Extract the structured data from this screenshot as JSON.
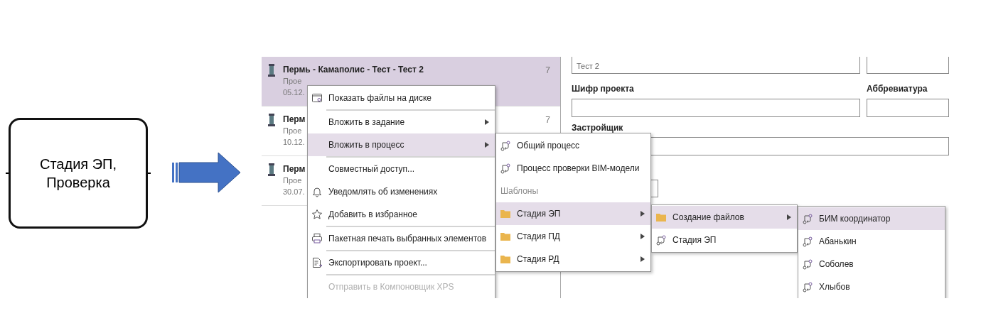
{
  "flow_node": {
    "text": "Стадия ЭП, Проверка"
  },
  "screenshot": {
    "projects": [
      {
        "title": "Пермь - Камаполис - Тест - Тест 2",
        "count": "7",
        "line_2": "Прое",
        "date": "05.12.",
        "selected": true
      },
      {
        "title": "Перм",
        "count": "7",
        "line_2": "Прое",
        "date": "10.12.",
        "selected": false
      },
      {
        "title": "Перм",
        "line_2": "Прое",
        "date": "30.07.",
        "selected": false
      }
    ],
    "form": {
      "field_value": "Тест 2",
      "labels": [
        "Шифр проекта",
        "Аббревиатура",
        "Застройщик"
      ]
    },
    "context_menu": {
      "items": [
        {
          "kind": "window",
          "label": "Показать файлы на диске",
          "has_submenu": false,
          "selected": false,
          "disabled": false
        },
        {
          "kind": "separator"
        },
        {
          "kind": "plain",
          "label": "Вложить в задание",
          "has_submenu": true,
          "selected": false,
          "disabled": false
        },
        {
          "kind": "plain",
          "label": "Вложить в процесс",
          "has_submenu": true,
          "selected": true,
          "disabled": false
        },
        {
          "kind": "separator"
        },
        {
          "kind": "plain",
          "label": "Совместный доступ...",
          "has_submenu": false,
          "selected": false,
          "disabled": false
        },
        {
          "kind": "bell",
          "label": "Уведомлять об изменениях",
          "has_submenu": false,
          "selected": false,
          "disabled": false
        },
        {
          "kind": "star",
          "label": "Добавить в избранное",
          "has_submenu": false,
          "selected": false,
          "disabled": false
        },
        {
          "kind": "separator"
        },
        {
          "kind": "printer",
          "label": "Пакетная печать выбранных элементов",
          "has_submenu": false,
          "selected": false,
          "disabled": false
        },
        {
          "kind": "separator"
        },
        {
          "kind": "document",
          "label": "Экспортировать проект...",
          "has_submenu": false,
          "selected": false,
          "disabled": false
        },
        {
          "kind": "separator"
        },
        {
          "kind": "plain",
          "label": "Отправить в Компоновщик XPS",
          "has_submenu": false,
          "selected": false,
          "disabled": true
        }
      ]
    },
    "submenus": [
      {
        "items": [
          {
            "kind": "process",
            "label": "Общий процесс",
            "has_submenu": false,
            "selected": false
          },
          {
            "kind": "process",
            "label": "Процесс проверки BIM-модели",
            "has_submenu": false,
            "selected": false
          },
          {
            "kind": "header",
            "label": "Шаблоны"
          },
          {
            "kind": "folder",
            "label": "Стадия ЭП",
            "has_submenu": true,
            "selected": true
          },
          {
            "kind": "folder",
            "label": "Стадия ПД",
            "has_submenu": true,
            "selected": false
          },
          {
            "kind": "folder",
            "label": "Стадия РД",
            "has_submenu": true,
            "selected": false
          }
        ]
      },
      {
        "items": [
          {
            "kind": "folder",
            "label": "Создание файлов",
            "has_submenu": true,
            "selected": true
          },
          {
            "kind": "process",
            "label": "Стадия ЭП",
            "has_submenu": false,
            "selected": false
          }
        ]
      },
      {
        "items": [
          {
            "kind": "process",
            "label": "БИМ координатор",
            "has_submenu": false,
            "selected": true
          },
          {
            "kind": "process",
            "label": "Абанькин",
            "has_submenu": false,
            "selected": false
          },
          {
            "kind": "process",
            "label": "Соболев",
            "has_submenu": false,
            "selected": false
          },
          {
            "kind": "process",
            "label": "Хлыбов",
            "has_submenu": false,
            "selected": false
          }
        ]
      }
    ]
  }
}
